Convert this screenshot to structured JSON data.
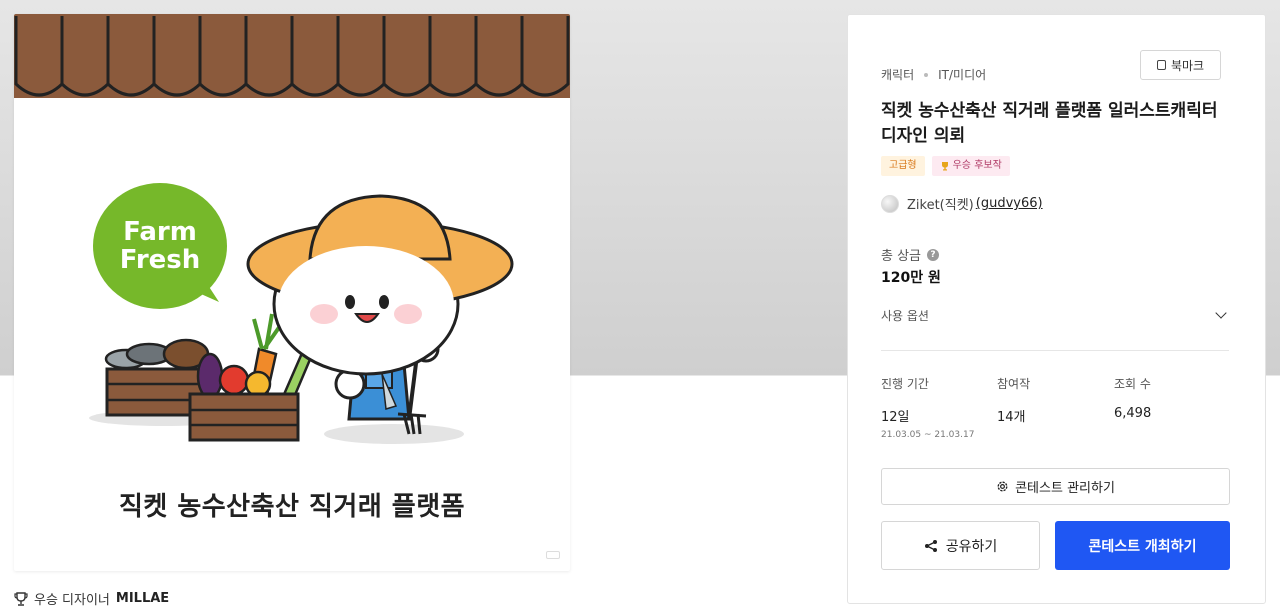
{
  "hero": {
    "bubble_line1": "Farm",
    "bubble_line2": "Fresh",
    "caption": "직켓 농수산축산 직거래 플랫폼"
  },
  "winner": {
    "prefix": "우승 디자이너",
    "name": "MILLAE"
  },
  "card": {
    "bookmark_label": "북마크",
    "category": "캐릭터",
    "subcategory": "IT/미디어",
    "title": "직켓 농수산축산 직거래 플랫폼 일러스트캐릭터 디자인 의뢰",
    "badge_grade": "고급형",
    "badge_candidate": "우승 후보작",
    "author_name": "Ziket(직켓)",
    "author_id": "(gudvy66)",
    "prize_label": "총 상금",
    "prize_help": "?",
    "prize_value": "120만 원",
    "options_label": "사용 옵션",
    "stats": [
      {
        "label": "진행 기간",
        "value": "12일",
        "sub": "21.03.05 ~ 21.03.17"
      },
      {
        "label": "참여작",
        "value": "14개"
      },
      {
        "label": "조회 수",
        "value": "6,498"
      }
    ],
    "manage_label": "콘테스트 관리하기",
    "share_label": "공유하기",
    "host_label": "콘테스트 개최하기"
  },
  "colors": {
    "primary": "#1f57f3",
    "awning": "#8b5a3c",
    "bubble": "#76b82a"
  }
}
